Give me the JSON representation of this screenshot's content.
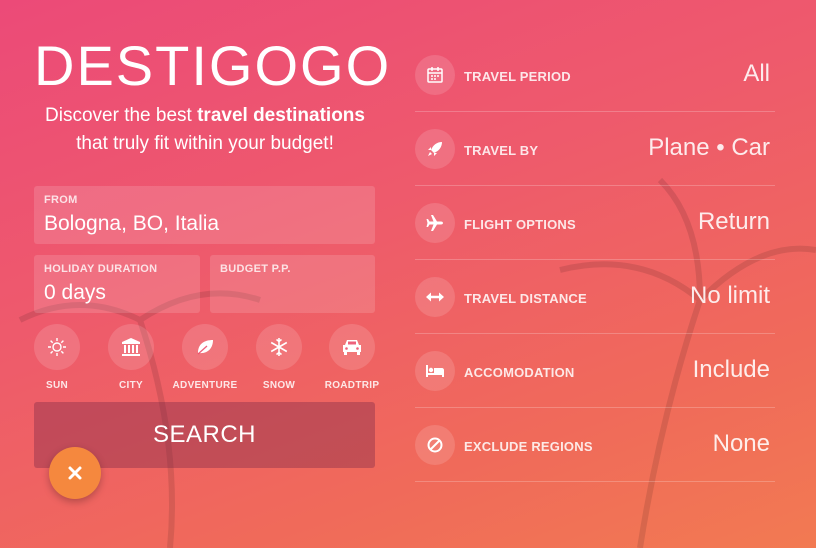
{
  "brand": {
    "title": "DESTIGOGO",
    "tagline_pre": "Discover the best ",
    "tagline_bold": "travel destinations",
    "tagline_line2": "that truly fit within your budget!"
  },
  "form": {
    "from": {
      "label": "FROM",
      "value": "Bologna, BO, Italia"
    },
    "duration": {
      "label": "HOLIDAY DURATION",
      "value": "0 days"
    },
    "budget": {
      "label": "BUDGET P.P.",
      "value": ""
    }
  },
  "categories": [
    {
      "name": "SUN",
      "icon": "sun-icon"
    },
    {
      "name": "CITY",
      "icon": "city-icon"
    },
    {
      "name": "ADVENTURE",
      "icon": "leaf-icon"
    },
    {
      "name": "SNOW",
      "icon": "snowflake-icon"
    },
    {
      "name": "ROADTRIP",
      "icon": "car-icon"
    }
  ],
  "search_label": "SEARCH",
  "fab_icon": "close-icon",
  "options": [
    {
      "label": "TRAVEL PERIOD",
      "value": "All",
      "icon": "calendar-icon"
    },
    {
      "label": "TRAVEL BY",
      "value": "Plane • Car",
      "icon": "rocket-icon"
    },
    {
      "label": "FLIGHT OPTIONS",
      "value": "Return",
      "icon": "plane-icon"
    },
    {
      "label": "TRAVEL DISTANCE",
      "value": "No limit",
      "icon": "arrows-horizontal-icon"
    },
    {
      "label": "ACCOMODATION",
      "value": "Include",
      "icon": "bed-icon"
    },
    {
      "label": "EXCLUDE REGIONS",
      "value": "None",
      "icon": "ban-icon"
    }
  ],
  "colors": {
    "gradient_start": "#ec4a78",
    "gradient_end": "#f27a52",
    "fab": "#f5883e"
  }
}
